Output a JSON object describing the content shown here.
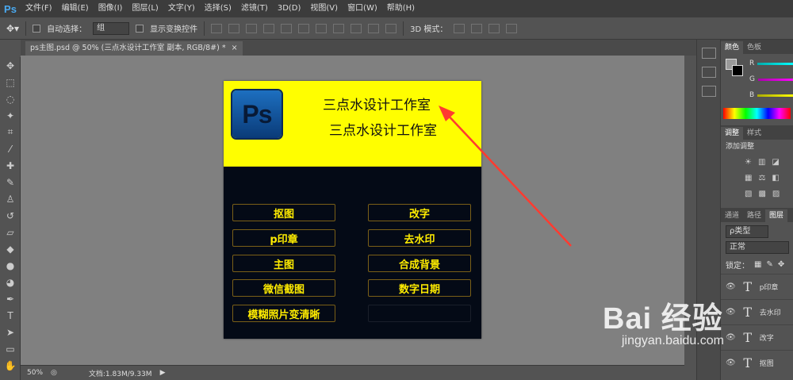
{
  "app": {
    "logo": "Ps"
  },
  "menu": [
    "文件(F)",
    "编辑(E)",
    "图像(I)",
    "图层(L)",
    "文字(Y)",
    "选择(S)",
    "滤镜(T)",
    "3D(D)",
    "视图(V)",
    "窗口(W)",
    "帮助(H)"
  ],
  "options": {
    "auto_select_label": "自动选择：",
    "auto_select_value": "组",
    "show_transform_label": "显示变换控件",
    "mode_3d_label": "3D 模式："
  },
  "document": {
    "tab_title": "ps主图.psd @ 50% (三点水设计工作室 副本, RGB/8#) *",
    "close": "×",
    "header": {
      "logo_text": "Ps",
      "title_line1": "三点水设计工作室",
      "title_line2": "三点水设计工作室"
    },
    "buttons_left": [
      "抠图",
      "p印章",
      "主图",
      "微信截图",
      "模糊照片变清晰"
    ],
    "buttons_right": [
      "改字",
      "去水印",
      "合成背景",
      "数字日期"
    ]
  },
  "status": {
    "zoom": "50%",
    "doc_size": "文档:1.83M/9.33M"
  },
  "panels": {
    "color_tabs": [
      "颜色",
      "色板"
    ],
    "rgb_labels": [
      "R",
      "G",
      "B"
    ],
    "adjust_tabs": [
      "调整",
      "样式"
    ],
    "adjust_title": "添加调整",
    "layer_tabs": [
      "通道",
      "路径",
      "图层"
    ],
    "filter_label": "ρ类型",
    "blend_mode": "正常",
    "lock_label": "锁定：",
    "layers": [
      "p印章",
      "去水印",
      "改字",
      "抠图"
    ]
  },
  "watermark": {
    "main": "Bai 经验",
    "sub": "jingyan.baidu.com"
  },
  "colors": {
    "header_yellow": "#fffe00",
    "doc_bg": "#040a16",
    "button_text": "#ffec00",
    "arrow": "#ff3b30"
  }
}
